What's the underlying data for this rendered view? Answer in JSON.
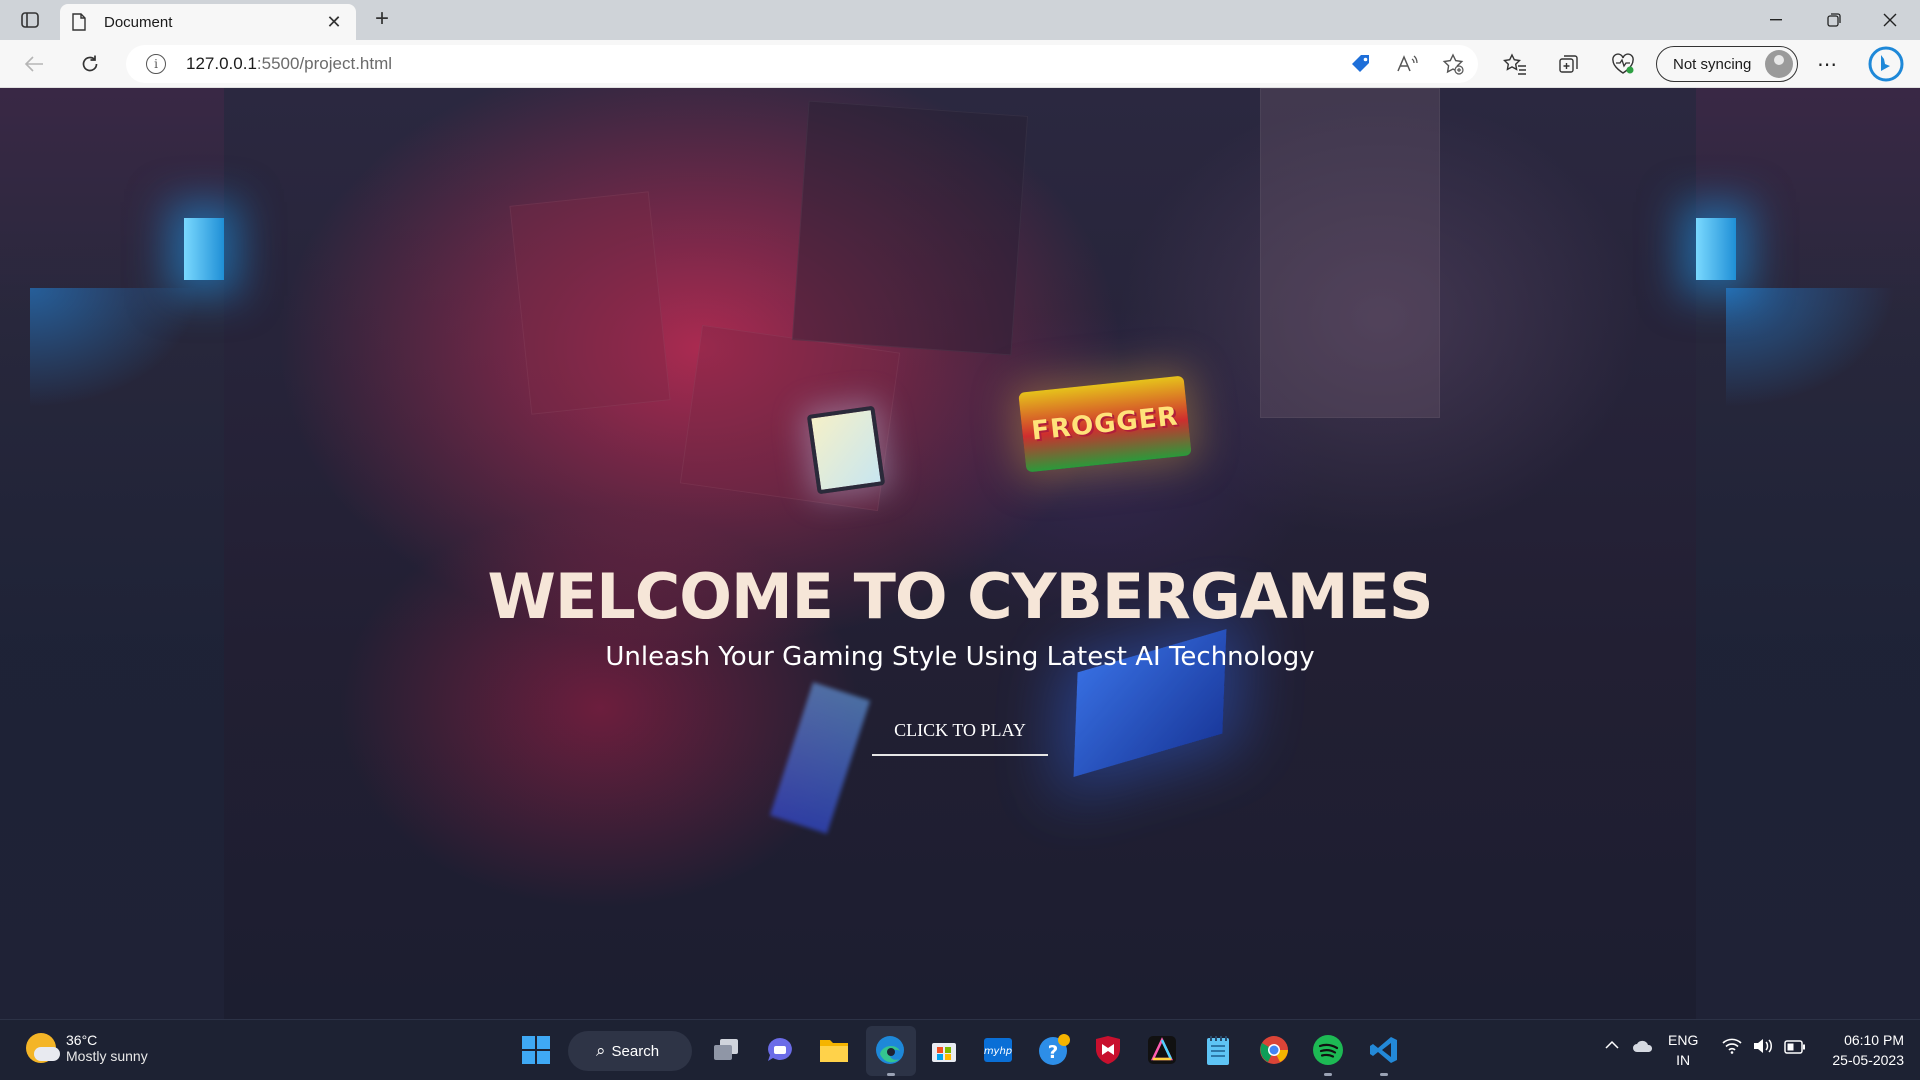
{
  "browser": {
    "tab_title": "Document",
    "new_tab_symbol": "+",
    "url_host": "127.0.0.1",
    "url_path": ":5500/project.html",
    "sync_label": "Not syncing"
  },
  "hero": {
    "title": "WELCOME TO CYBERGAMES",
    "subtitle": "Unleash Your Gaming Style Using Latest AI Technology",
    "cta_label": "CLICK TO PLAY",
    "marquee_text": "FROGGER"
  },
  "taskbar": {
    "weather_temp": "36°C",
    "weather_condition": "Mostly sunny",
    "search_label": "Search",
    "language_line1": "ENG",
    "language_line2": "IN",
    "time": "06:10 PM",
    "date": "25-05-2023",
    "pinned_apps": [
      "start-icon",
      "task-view-icon",
      "teams-chat-icon",
      "file-explorer-icon",
      "edge-icon",
      "microsoft-store-icon",
      "myhp-icon",
      "help-icon",
      "mcafee-icon",
      "affinity-icon",
      "notepad-icon",
      "chrome-icon",
      "spotify-icon",
      "vscode-icon"
    ]
  },
  "colors": {
    "hero_title": "#f6e6d8",
    "accent_pink": "#d62c58",
    "taskbar_bg": "#1d2233",
    "edge_blue": "#1e88d8"
  }
}
